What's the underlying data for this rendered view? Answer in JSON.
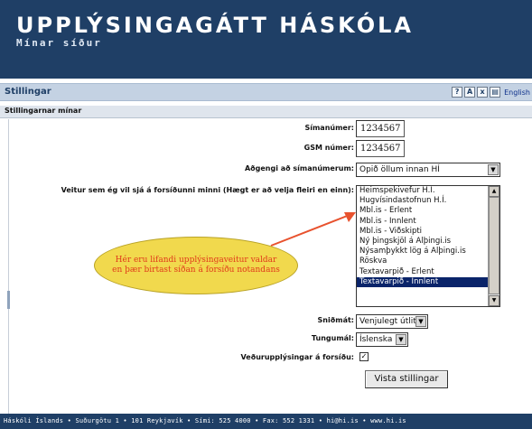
{
  "header": {
    "title": "UPPLÝSINGAGÁTT HÁSKÓLA",
    "subtitle": "Mínar síður"
  },
  "titlebar": {
    "label": "Stillingar",
    "icons": [
      {
        "name": "help-icon",
        "glyph": "?"
      },
      {
        "name": "font-icon",
        "glyph": "A"
      },
      {
        "name": "close-icon",
        "glyph": "x"
      },
      {
        "name": "print-icon",
        "glyph": "▤"
      }
    ],
    "english_link": "English"
  },
  "section": {
    "title": "Stillingarnar mínar"
  },
  "form": {
    "phone_label": "Símanúmer:",
    "phone_value": "1234567",
    "gsm_label": "GSM númer:",
    "gsm_value": "1234567",
    "access_label": "Aðgengi að símanúmerum:",
    "access_value": "Opið öllum innan HÍ",
    "feeds_label": "Veitur sem ég vil sjá á forsíðunni minni (Hægt er að velja fleiri en einn):",
    "feeds": [
      {
        "label": "Heimspekivefur H.Í.",
        "selected": false
      },
      {
        "label": "Hugvísindastofnun H.Í.",
        "selected": false
      },
      {
        "label": "Mbl.is - Erlent",
        "selected": false
      },
      {
        "label": "Mbl.is - Innlent",
        "selected": false
      },
      {
        "label": "Mbl.is - Viðskipti",
        "selected": false
      },
      {
        "label": "Ný þingskjöl á Alþingi.is",
        "selected": false
      },
      {
        "label": "Nýsamþykkt lög á Alþingi.is",
        "selected": false
      },
      {
        "label": "Röskva",
        "selected": false
      },
      {
        "label": "Textavarpið - Erlent",
        "selected": false
      },
      {
        "label": "Textavarpið - Innlent",
        "selected": true
      }
    ],
    "template_label": "Sniðmát:",
    "template_value": "Venjulegt útlit",
    "language_label": "Tungumál:",
    "language_value": "Íslenska",
    "weather_label": "Veðurupplýsingar á forsíðu:",
    "weather_checked": true,
    "submit_label": "Vista stillingar"
  },
  "callout": {
    "text": "Hér eru lifandi upplýsingaveitur valdar en þær birtast síðan á forsíðu notandans"
  },
  "footer": {
    "text": "Háskóli Íslands • Suðurgötu 1 • 101 Reykjavík • Sími: 525 4000 • Fax: 552 1331 • hi@hi.is • www.hi.is"
  },
  "colors": {
    "banner": "#1f3f66",
    "titlebar": "#c4d2e3",
    "callout_fill": "#f1d94d",
    "callout_text": "#e03a1a",
    "arrow": "#e8522e",
    "selected_item": "#0a246a"
  }
}
